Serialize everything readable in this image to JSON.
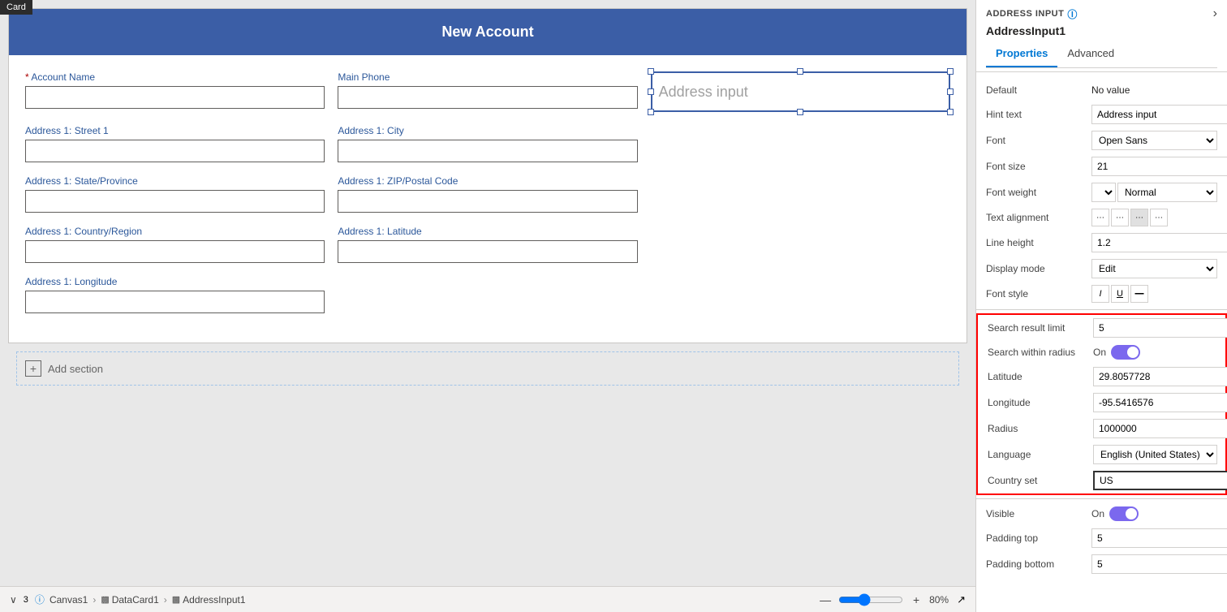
{
  "panel": {
    "component_name": "ADDRESS INPUT",
    "instance_name": "AddressInput1",
    "tab_properties": "Properties",
    "tab_advanced": "Advanced",
    "arrow_label": "›"
  },
  "properties": {
    "default_label": "Default",
    "default_value": "No value",
    "hint_text_label": "Hint text",
    "hint_text_value": "Address input",
    "font_label": "Font",
    "font_value": "Open Sans",
    "font_size_label": "Font size",
    "font_size_value": "21",
    "font_weight_label": "Font weight",
    "font_weight_value": "Normal",
    "text_alignment_label": "Text alignment",
    "line_height_label": "Line height",
    "line_height_value": "1.2",
    "display_mode_label": "Display mode",
    "display_mode_value": "Edit",
    "font_style_label": "Font style",
    "search_result_limit_label": "Search result limit",
    "search_result_limit_value": "5",
    "search_within_radius_label": "Search within radius",
    "search_within_radius_value": "On",
    "latitude_label": "Latitude",
    "latitude_value": "29.8057728",
    "longitude_label": "Longitude",
    "longitude_value": "-95.5416576",
    "radius_label": "Radius",
    "radius_value": "1000000",
    "language_label": "Language",
    "language_value": "English (United States)",
    "country_set_label": "Country set",
    "country_set_value": "US",
    "visible_label": "Visible",
    "visible_value": "On",
    "padding_top_label": "Padding top",
    "padding_top_value": "5",
    "padding_bottom_label": "Padding bottom",
    "padding_bottom_value": "5"
  },
  "form": {
    "title": "New Account",
    "fields": [
      {
        "label": "Account Name",
        "required": true,
        "col": 0,
        "row": 0
      },
      {
        "label": "Main Phone",
        "required": false,
        "col": 1,
        "row": 0
      },
      {
        "label": "Address 1: Street 1",
        "required": false,
        "col": 0,
        "row": 1
      },
      {
        "label": "Address 1: City",
        "required": false,
        "col": 1,
        "row": 1
      },
      {
        "label": "Address 1: State/Province",
        "required": false,
        "col": 0,
        "row": 2
      },
      {
        "label": "Address 1: ZIP/Postal Code",
        "required": false,
        "col": 1,
        "row": 2
      },
      {
        "label": "Address 1: Country/Region",
        "required": false,
        "col": 0,
        "row": 3
      },
      {
        "label": "Address 1: Latitude",
        "required": false,
        "col": 1,
        "row": 3
      },
      {
        "label": "Address 1: Longitude",
        "required": false,
        "col": 0,
        "row": 4
      }
    ],
    "address_input_placeholder": "Address input",
    "add_section_label": "Add section"
  },
  "bottom_bar": {
    "canvas_label": "Canvas1",
    "datacard_label": "DataCard1",
    "addressinput_label": "AddressInput1",
    "zoom_value": "80",
    "zoom_percent": "%",
    "minus_label": "—",
    "plus_label": "+"
  },
  "card_label": "Card"
}
